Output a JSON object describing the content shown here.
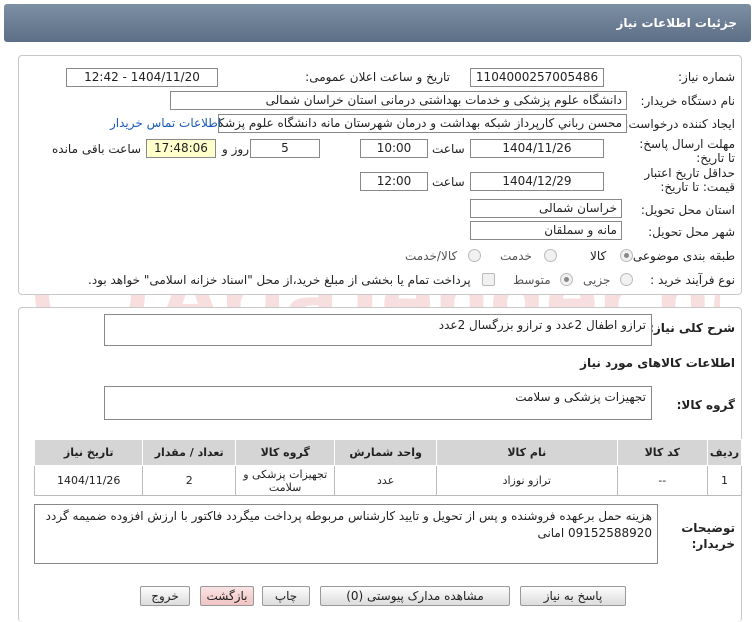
{
  "header": {
    "title": "جزئیات اطلاعات نیاز"
  },
  "form": {
    "need_number_label": "شماره نیاز:",
    "need_number": "1104000257005486",
    "announce_label": "تاریخ و ساعت اعلان عمومی:",
    "announce_value": "1404/11/20 - 12:42",
    "buyer_org_label": "نام دستگاه خریدار:",
    "buyer_org": "دانشگاه علوم پزشکی و خدمات بهداشتی درمانی استان خراسان شمالی",
    "requester_label": "ایجاد کننده درخواست:",
    "requester": "محسن رباني كارپرداز شبكه بهداشت و درمان شهرستان مانه دانشگاه علوم پزشكي و خدمات بهداشتي درماني استان خراسان شمالي",
    "contact_link": "اطلاعات تماس خریدار",
    "reply_deadline_label": "مهلت ارسال پاسخ: تا تاریخ:",
    "reply_date": "1404/11/26",
    "time_label": "ساعت",
    "reply_time": "10:00",
    "days": "5",
    "days_label": "روز و",
    "remaining_time": "17:48:06",
    "remaining_label": "ساعت باقی مانده",
    "price_validity_label": "حداقل تاریخ اعتبار قیمت: تا تاریخ:",
    "validity_date": "1404/12/29",
    "validity_time": "12:00",
    "province_label": "استان محل تحویل:",
    "province": "خراسان شمالی",
    "city_label": "شهر محل تحویل:",
    "city": "مانه و سملقان",
    "category_label": "طبقه بندی موضوعی:",
    "category_options": [
      "کالا",
      "خدمت",
      "کالا/خدمت"
    ],
    "category_selected": "کالا",
    "process_label": "نوع فرآیند خرید :",
    "process_options": [
      "جزیی",
      "متوسط"
    ],
    "process_selected": "جزیی",
    "treasury_note": "پرداخت تمام یا بخشی از مبلغ خرید،از محل \"اسناد خزانه اسلامی\" خواهد بود."
  },
  "description": {
    "label": "شرح کلی نیاز:",
    "text": "ترازو اطفال 2عدد و ترازو بزرگسال 2عدد"
  },
  "goods": {
    "section_title": "اطلاعات کالاهای مورد نیاز",
    "group_label": "گروه کالا:",
    "group_value": "تجهیزات پزشکی و سلامت",
    "columns": [
      "ردیف",
      "کد کالا",
      "نام کالا",
      "واحد شمارش",
      "گروه کالا",
      "تعداد / مقدار",
      "تاریخ نیاز"
    ],
    "rows": [
      [
        "1",
        "--",
        "ترازو نوزاد",
        "عدد",
        "تجهیزات پزشکی و سلامت",
        "2",
        "1404/11/26"
      ]
    ]
  },
  "buyer_notes": {
    "label": "توضیحات خریدار:",
    "text": "هزینه حمل برعهده فروشنده و پس از تحویل و تایید کارشناس مربوطه پرداخت میگردد فاکتور با ارزش افزوده ضمیمه گردد 09152588920 امانی"
  },
  "buttons": {
    "reply": "پاسخ به نیاز",
    "attachments": "مشاهده مدارک پیوستی (0)",
    "print": "چاپ",
    "back": "بازگشت",
    "exit": "خروج"
  },
  "watermark": {
    "text": "AriaTender.net"
  },
  "colors": {
    "header": "#6a7d93",
    "link": "#1a5ab8",
    "timer_bg": "#ffffcc",
    "back_btn": "#f4c9c9"
  }
}
